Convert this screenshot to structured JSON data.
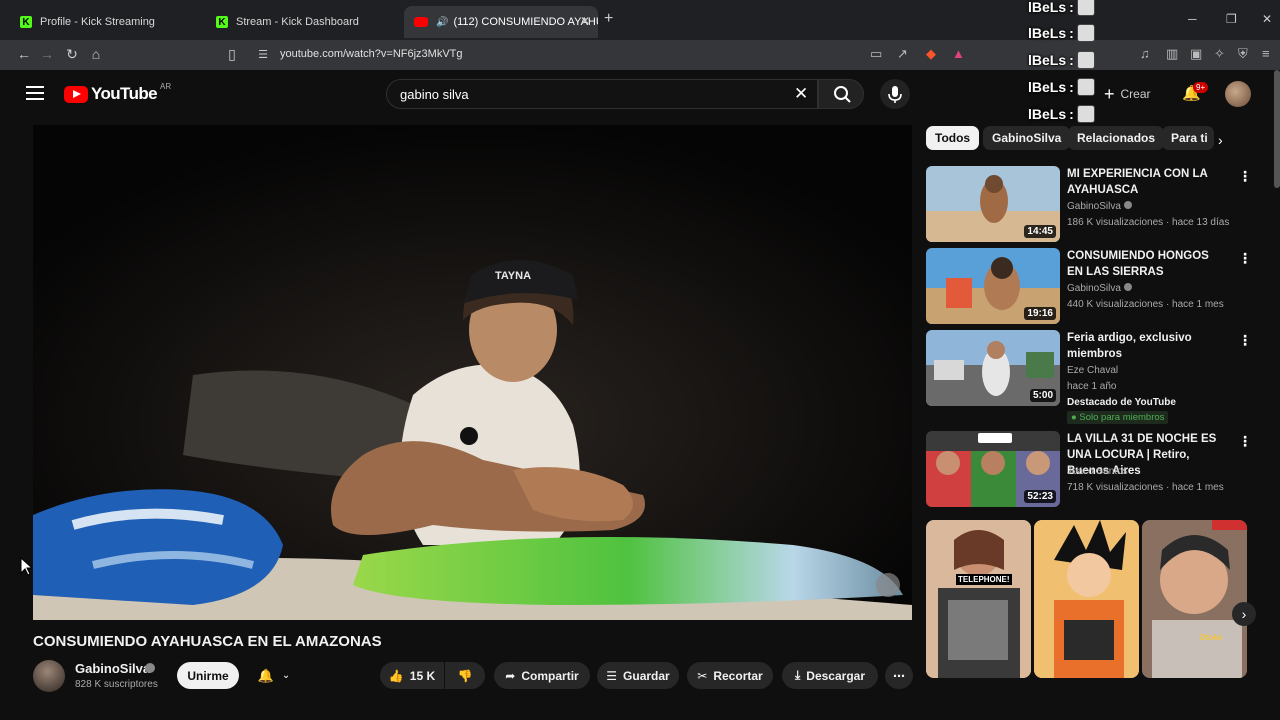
{
  "browser": {
    "tabs": [
      {
        "label": "Profile - Kick Streaming",
        "icon": "kick-icon"
      },
      {
        "label": "Stream - Kick Dashboard",
        "icon": "kick-icon"
      },
      {
        "label": "(112) CONSUMIENDO AYAHU",
        "icon": "youtube-icon",
        "active": true
      }
    ],
    "url": "youtube.com/watch?v=NF6jz3MkVTg"
  },
  "chat_overlay": {
    "lines": [
      {
        "user": "lBeLs",
        "sep": ":"
      },
      {
        "user": "lBeLs",
        "sep": ":"
      },
      {
        "user": "lBeLs",
        "sep": ":"
      },
      {
        "user": "lBeLs",
        "sep": ":"
      },
      {
        "user": "lBeLs",
        "sep": ":"
      }
    ]
  },
  "header": {
    "logo_text": "YouTube",
    "country": "AR",
    "search_value": "gabino silva",
    "create_label": "Crear",
    "notif_badge": "9+"
  },
  "video": {
    "title": "CONSUMIENDO AYAHUASCA EN EL AMAZONAS",
    "cap_text": "TAYNA",
    "channel": "GabinoSilva",
    "subscribers": "828 K suscriptores",
    "join_label": "Unirme",
    "likes": "15 K",
    "share_label": "Compartir",
    "save_label": "Guardar",
    "clip_label": "Recortar",
    "download_label": "Descargar"
  },
  "chips": [
    "Todos",
    "GabinoSilva",
    "Relacionados",
    "Para ti"
  ],
  "recommendations": [
    {
      "title": "MI EXPERIENCIA CON LA AYAHUASCA",
      "channel": "GabinoSilva",
      "verified": true,
      "stats": "186 K visualizaciones · hace 13 días",
      "duration": "14:45"
    },
    {
      "title": "CONSUMIENDO HONGOS EN LAS SIERRAS",
      "channel": "GabinoSilva",
      "verified": true,
      "stats": "440 K visualizaciones · hace 1 mes",
      "duration": "19:16"
    },
    {
      "title": "Feria ardigo, exclusivo miembros",
      "channel": "Eze Chaval",
      "verified": false,
      "stats": "hace 1 año",
      "featured": "Destacado de YouTube",
      "members": "Solo para miembros",
      "duration": "5:00"
    },
    {
      "title": "LA VILLA 31 DE NOCHE ES UNA LOCURA | Retiro, Buenos Aires",
      "channel": "Joaco Santos",
      "verified": false,
      "stats": "718 K visualizaciones · hace 1 mes",
      "duration": "52:23"
    }
  ],
  "shorts": [
    {
      "caption": "TELEPHONE!"
    },
    {
      "caption": ""
    },
    {
      "caption": "Dtoke"
    }
  ]
}
